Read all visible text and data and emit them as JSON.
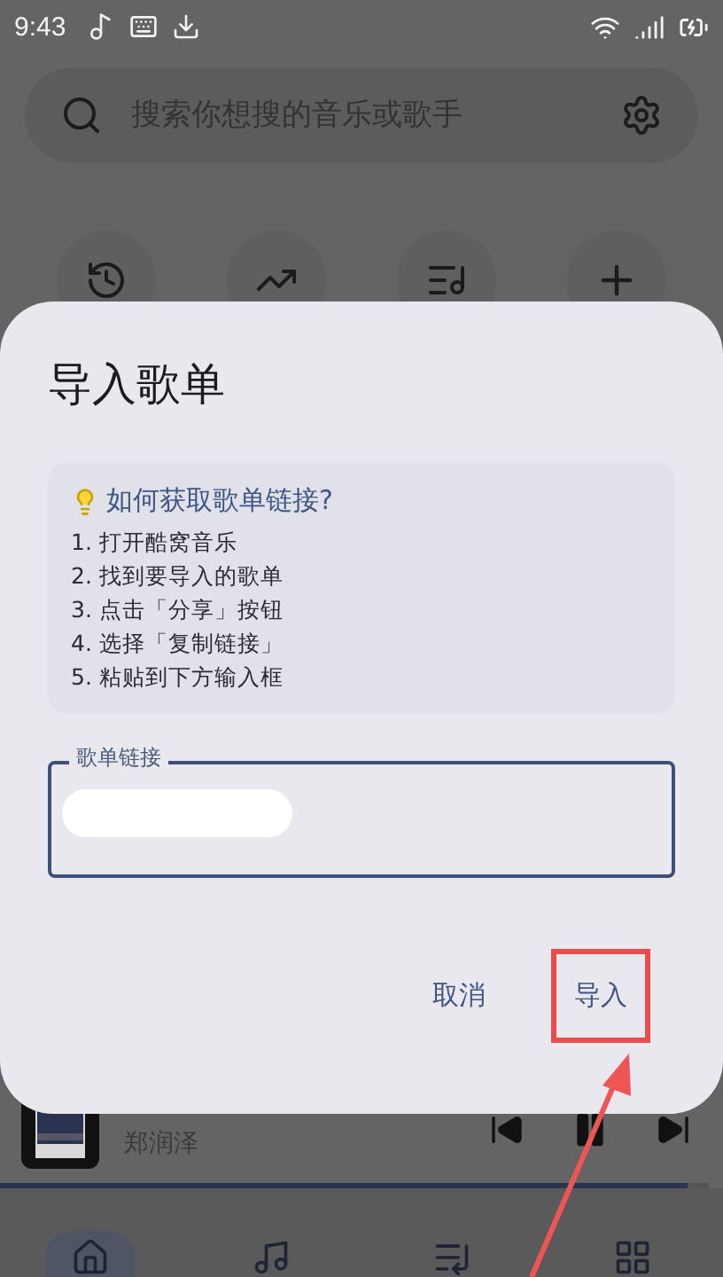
{
  "status_bar": {
    "time": "9:43"
  },
  "search": {
    "placeholder": "搜索你想搜的音乐或歌手"
  },
  "quick_actions": [
    {
      "kind": "history"
    },
    {
      "kind": "trending"
    },
    {
      "kind": "library"
    },
    {
      "kind": "add"
    }
  ],
  "dialog": {
    "title": "导入歌单",
    "help": {
      "heading": "如何获取歌单链接?",
      "steps": [
        "1. 打开酷窝音乐",
        "2. 找到要导入的歌单",
        "3. 点击「分享」按钮",
        "4. 选择「复制链接」",
        "5. 粘贴到下方输入框"
      ]
    },
    "field": {
      "label": "歌单链接"
    },
    "buttons": [
      {
        "label": "取消",
        "highlighted": false
      },
      {
        "label": "导入",
        "highlighted": true
      }
    ]
  },
  "player": {
    "artist": "郑润泽",
    "level": 0.97
  },
  "nav": [
    {
      "kind": "home",
      "selected": true
    },
    {
      "kind": "music",
      "selected": false
    },
    {
      "kind": "queue",
      "selected": false
    },
    {
      "kind": "grid",
      "selected": false
    }
  ]
}
